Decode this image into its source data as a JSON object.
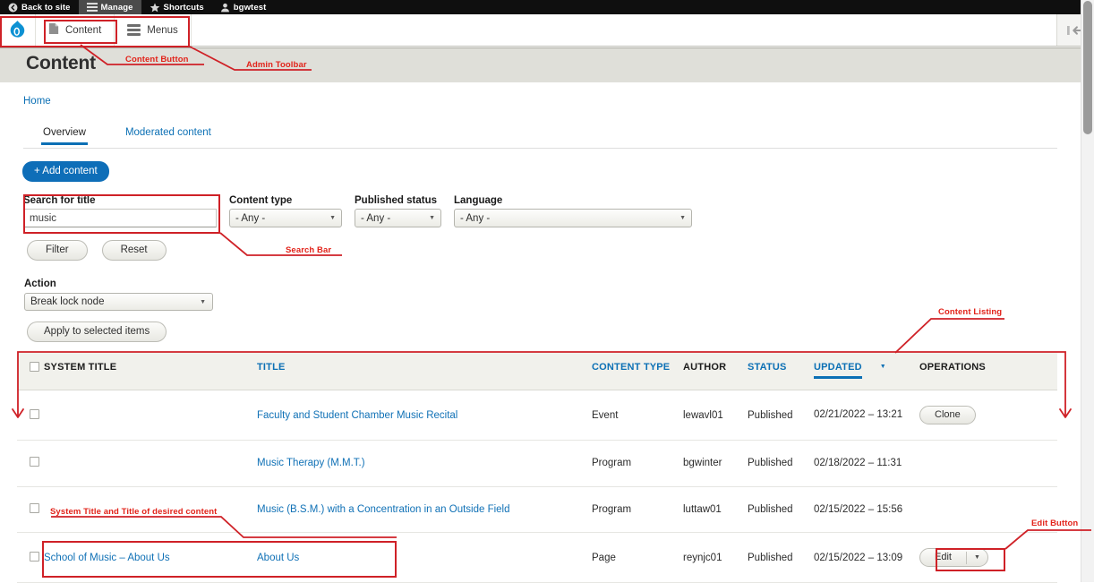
{
  "admin_bar": {
    "items": [
      {
        "label": "Back to site",
        "icon": "back-arrow-icon",
        "active": false
      },
      {
        "label": "Manage",
        "icon": "hamburger-icon",
        "active": true
      },
      {
        "label": "Shortcuts",
        "icon": "star-icon",
        "active": false
      },
      {
        "label": "bgwtest",
        "icon": "user-icon",
        "active": false
      }
    ]
  },
  "toolbar": {
    "logo": "drupal-logo-icon",
    "content_label": "Content",
    "menus_label": "Menus",
    "collapse_icon": "collapse-toolbar-icon"
  },
  "page": {
    "title": "Content",
    "breadcrumb": "Home"
  },
  "tabs": [
    {
      "label": "Overview",
      "active": true
    },
    {
      "label": "Moderated content",
      "active": false
    }
  ],
  "add_content_label": "+ Add content",
  "filters": {
    "search": {
      "label": "Search for title",
      "value": "music",
      "placeholder": ""
    },
    "content_type": {
      "label": "Content type",
      "value": "- Any -"
    },
    "published_status": {
      "label": "Published status",
      "value": "- Any -"
    },
    "language": {
      "label": "Language",
      "value": "- Any -"
    },
    "filter_label": "Filter",
    "reset_label": "Reset"
  },
  "action": {
    "label": "Action",
    "value": "Break lock node",
    "apply_label": "Apply to selected items"
  },
  "table": {
    "columns": [
      {
        "key": "checkbox",
        "label": "",
        "link": false
      },
      {
        "key": "system_title",
        "label": "SYSTEM TITLE",
        "link": false
      },
      {
        "key": "title",
        "label": "TITLE",
        "link": true
      },
      {
        "key": "content_type",
        "label": "CONTENT TYPE",
        "link": true
      },
      {
        "key": "author",
        "label": "AUTHOR",
        "link": false
      },
      {
        "key": "status",
        "label": "STATUS",
        "link": true
      },
      {
        "key": "updated",
        "label": "UPDATED",
        "link": true,
        "sorted": true
      },
      {
        "key": "operations",
        "label": "OPERATIONS",
        "link": false
      }
    ],
    "rows": [
      {
        "system_title": "",
        "title": "Faculty and Student Chamber Music Recital",
        "content_type": "Event",
        "author": "lewavl01",
        "status": "Published",
        "updated": "02/21/2022 – 13:21",
        "operation": "Clone",
        "has_split": false
      },
      {
        "system_title": "",
        "title": "Music Therapy (M.M.T.)",
        "content_type": "Program",
        "author": "bgwinter",
        "status": "Published",
        "updated": "02/18/2022 – 11:31",
        "operation": "",
        "has_split": false
      },
      {
        "system_title": "",
        "title": "Music (B.S.M.) with a Concentration in an Outside Field",
        "content_type": "Program",
        "author": "luttaw01",
        "status": "Published",
        "updated": "02/15/2022 – 15:56",
        "operation": "",
        "has_split": false
      },
      {
        "system_title": "School of Music – About Us",
        "title": "About Us",
        "content_type": "Page",
        "author": "reynjc01",
        "status": "Published",
        "updated": "02/15/2022 – 13:09",
        "operation": "Edit",
        "has_split": true
      }
    ]
  },
  "annotations": {
    "color": "#e2231a",
    "labels": [
      {
        "id": "content-button",
        "text": "Content Button"
      },
      {
        "id": "admin-toolbar",
        "text": "Admin Toolbar"
      },
      {
        "id": "search-bar",
        "text": "Search Bar"
      },
      {
        "id": "content-listing",
        "text": "Content Listing"
      },
      {
        "id": "system-title",
        "text": "System Title and Title of desired content"
      },
      {
        "id": "edit-button",
        "text": "Edit Button"
      }
    ]
  }
}
